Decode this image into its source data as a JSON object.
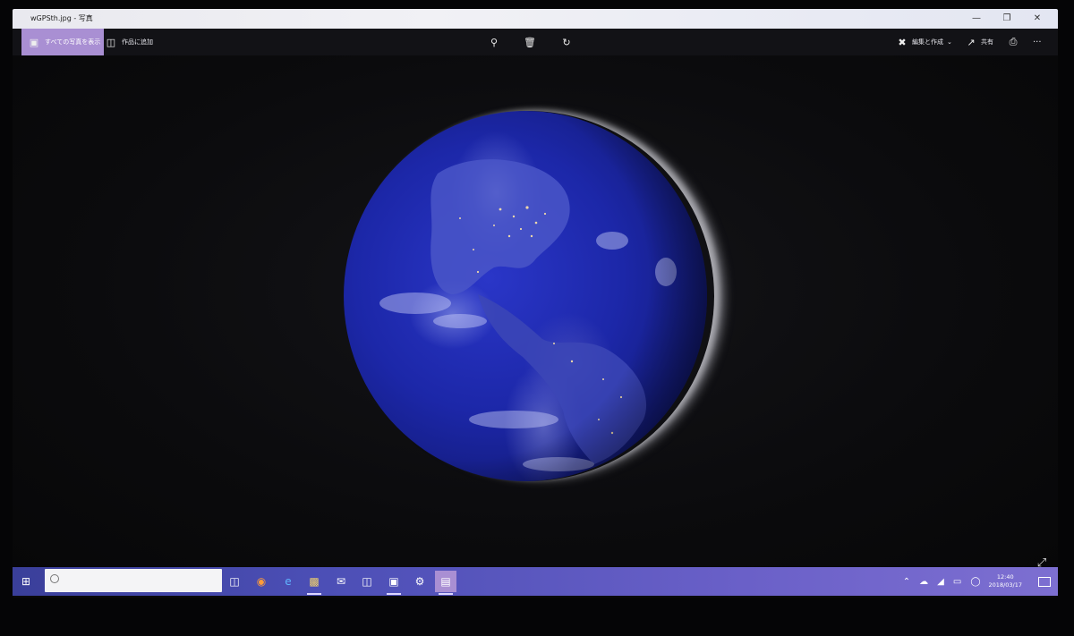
{
  "window": {
    "title": "wGPSth.jpg - 写真",
    "minimize_icon": "minimize-icon",
    "maximize_icon": "restore-icon",
    "close_icon": "close-icon"
  },
  "toolbar": {
    "see_all_photos": "すべての写真を表示",
    "add_to_creation": "作品に追加",
    "edit_create": "編集と作成",
    "share": "共有",
    "more": "···"
  },
  "colors": {
    "accent": "#a98fd3",
    "taskbar_start": "#3a3f9a",
    "taskbar_end": "#7d6fd1",
    "earth": "#1c27a8"
  },
  "taskbar": {
    "search_placeholder": "",
    "apps": [
      "task-view-icon",
      "firefox-icon",
      "edge-icon",
      "file-explorer-icon",
      "mail-icon",
      "store-icon",
      "photos-app-icon",
      "settings-icon",
      "photos-running-icon"
    ],
    "clock_time": "12:40",
    "clock_date": "2018/03/17"
  }
}
